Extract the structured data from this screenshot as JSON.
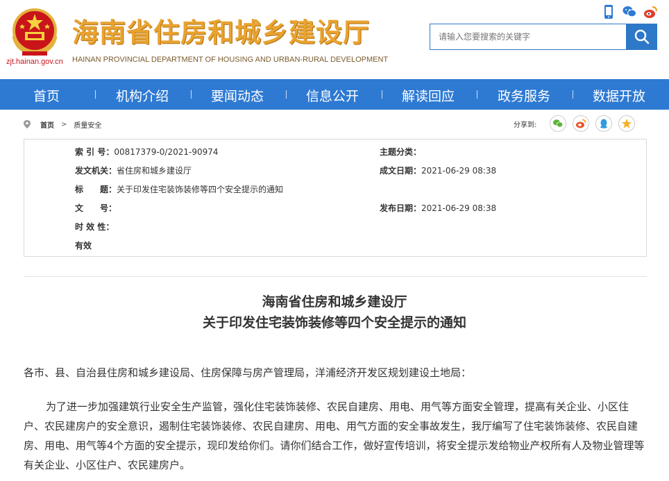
{
  "header": {
    "site_url": "zjt.hainan.gov.cn",
    "title": "海南省住房和城乡建设厅",
    "subtitle": "HAINAN PROVINCIAL DEPARTMENT OF HOUSING AND URBAN-RURAL DEVELOPMENT",
    "icons": [
      "mobile-icon",
      "wechat-icon",
      "weibo-icon"
    ],
    "emblem": "national-emblem"
  },
  "search": {
    "placeholder": "请输入您要搜索的关键字"
  },
  "nav": {
    "items": [
      "首页",
      "机构介绍",
      "要闻动态",
      "信息公开",
      "解读回应",
      "政务服务",
      "数据开放"
    ]
  },
  "breadcrumb": {
    "home": "首页",
    "separator": ">",
    "current": "质量安全"
  },
  "share": {
    "label": "分享到:",
    "icons": [
      "wechat-icon",
      "weibo-icon",
      "qq-icon",
      "qzone-icon"
    ]
  },
  "meta": {
    "index_label": "索 引 号：",
    "index_value": "00817379-0/2021-90974",
    "topic_label": "主题分类：",
    "topic_value": "",
    "issuer_label": "发文机关：",
    "issuer_value": "省住房和城乡建设厅",
    "date_label": "成文日期：",
    "date_value": "2021-06-29 08:38",
    "title_label": "标　　题：",
    "title_value": "关于印发住宅装饰装修等四个安全提示的通知",
    "doc_no_label": "文　　号：",
    "doc_no_value": "",
    "publish_label": "发布日期：",
    "publish_value": "2021-06-29 08:38",
    "validity_label": "时 效 性：",
    "validity_value": "有效"
  },
  "article": {
    "title_line1": "海南省住房和城乡建设厅",
    "title_line2": "关于印发住宅装饰装修等四个安全提示的通知",
    "salutation": "各市、县、自治县住房和城乡建设局、住房保障与房产管理局，洋浦经济开发区规划建设土地局：",
    "body": "为了进一步加强建筑行业安全生产监管，强化住宅装饰装修、农民自建房、用电、用气等方面安全管理，提高有关企业、小区住户、农民建房户的安全意识，遏制住宅装饰装修、农民自建房、用电、用气方面的安全事故发生，我厅编写了住宅装饰装修、农民自建房、用电、用气等4个方面的安全提示，现印发给你们。请你们结合工作，做好宣传培训，将安全提示发给物业产权所有人及物业管理等有关企业、小区住户、农民建房户。"
  },
  "colors": {
    "nav_bg": "#2e7ad3",
    "title_gold": "#e8a330",
    "emblem_red": "#c9141a"
  }
}
